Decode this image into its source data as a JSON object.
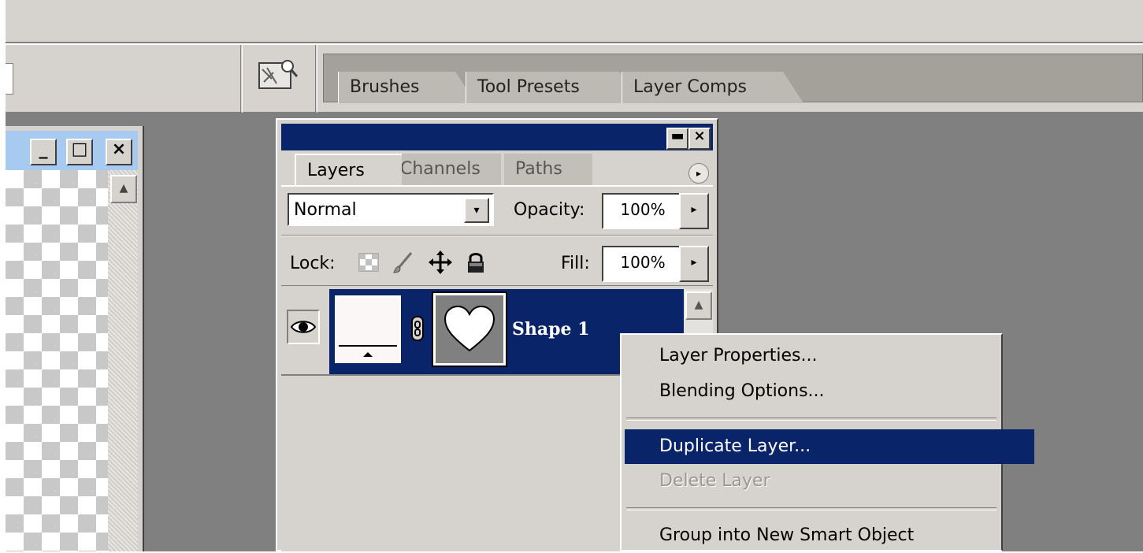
{
  "palette_well": {
    "tabs": [
      "Brushes",
      "Tool Presets",
      "Layer Comps"
    ]
  },
  "doc_window": {
    "minimize": "_",
    "maximize": "□",
    "close": "×",
    "scroll_up": "▲"
  },
  "layers_palette": {
    "tabs": [
      "Layers",
      "Channels",
      "Paths"
    ],
    "blend_mode": "Normal",
    "opacity_label": "Opacity:",
    "opacity_value": "100%",
    "lock_label": "Lock:",
    "fill_label": "Fill:",
    "fill_value": "100%",
    "minimize": "▬",
    "close": "×",
    "menu_arrow": "▸",
    "field_arrow": "▸",
    "dropdown_arrow": "▾",
    "layer": {
      "name": "Shape 1"
    }
  },
  "context_menu": {
    "items": [
      {
        "label": "Layer Properties..."
      },
      {
        "label": "Blending Options..."
      },
      {
        "label": "Duplicate Layer..."
      },
      {
        "label": "Delete Layer"
      },
      {
        "label": "Group into New Smart Object"
      }
    ]
  },
  "colors": {
    "selection": "#0a246a",
    "panel_bg": "#d6d3ce",
    "workspace": "#808080"
  }
}
